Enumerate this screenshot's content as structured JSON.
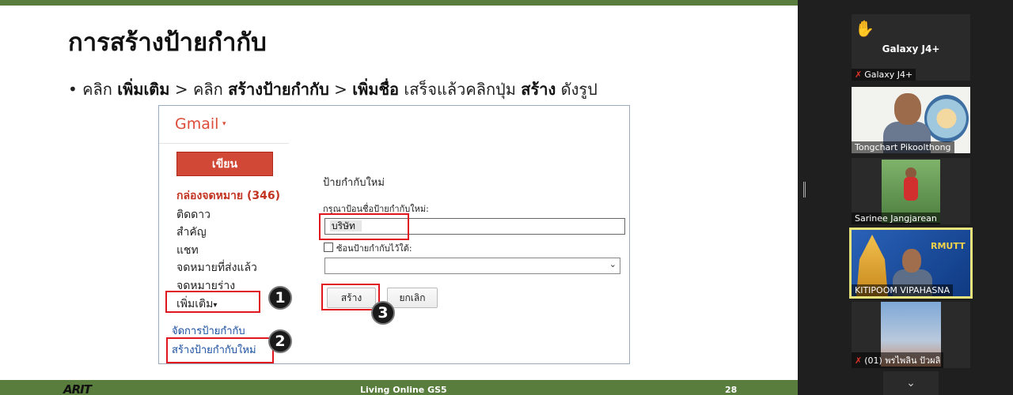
{
  "slide": {
    "title": "การสร้างป้ายกำกับ",
    "bullet": {
      "p1": "คลิก ",
      "b1": "เพิ่มเติม",
      "p2": " > คลิก ",
      "b2": "สร้างป้ายกำกับ",
      "p3": " > ",
      "b3": "เพิ่มชื่อ",
      "p4": " เสร็จแล้วคลิกปุ่ม ",
      "b4": "สร้าง",
      "p5": " ดังรูป"
    },
    "footer": {
      "center": "Living Online GS5",
      "page": "28",
      "logo": "ARIT"
    }
  },
  "gmail": {
    "logo": "Gmail",
    "logo_arrow": "▾",
    "compose": "เขียน",
    "nav": {
      "inbox": "กล่องจดหมาย (346)",
      "starred": "ติดดาว",
      "important": "สำคัญ",
      "chat": "แชท",
      "sent": "จดหมายที่ส่งแล้ว",
      "drafts": "จดหมายร่าง",
      "more": "เพิ่มเติม",
      "more_arrow": "▾",
      "manage_labels": "จัดการป้ายกำกับ",
      "create_label": "สร้างป้ายกำกับใหม่"
    },
    "dialog": {
      "title": "ป้ายกำกับใหม่",
      "prompt": "กรุณาป้อนชื่อป้ายกำกับใหม่:",
      "name_value": "บริษัท",
      "nest_label": "ซ้อนป้ายกำกับไว้ใต้:",
      "create_button": "สร้าง",
      "cancel_button": "ยกเลิก"
    },
    "markers": [
      "1",
      "2",
      "3"
    ]
  },
  "zoom": {
    "raised_hand_icon": "✋",
    "active_name": "Galaxy J4+",
    "participants": [
      {
        "name": "Galaxy J4+",
        "muted": true
      },
      {
        "name": "Tongchart Pikoolthong",
        "muted": false
      },
      {
        "name": "Sarinee Jangjarean",
        "muted": false
      },
      {
        "name": "KITIPOOM VIPAHASNA",
        "muted": false
      },
      {
        "name": "(01) พรไพลิน ปัวผลิ",
        "muted": true
      }
    ],
    "mic_muted_icon": "✗",
    "t4_banner": "RMUTT",
    "scroll_icon": "⌄"
  },
  "colors": {
    "slide_green": "#587d3c",
    "highlight_red": "#e0171f",
    "gmail_red": "#d14836",
    "active_border": "#e8e37a"
  }
}
